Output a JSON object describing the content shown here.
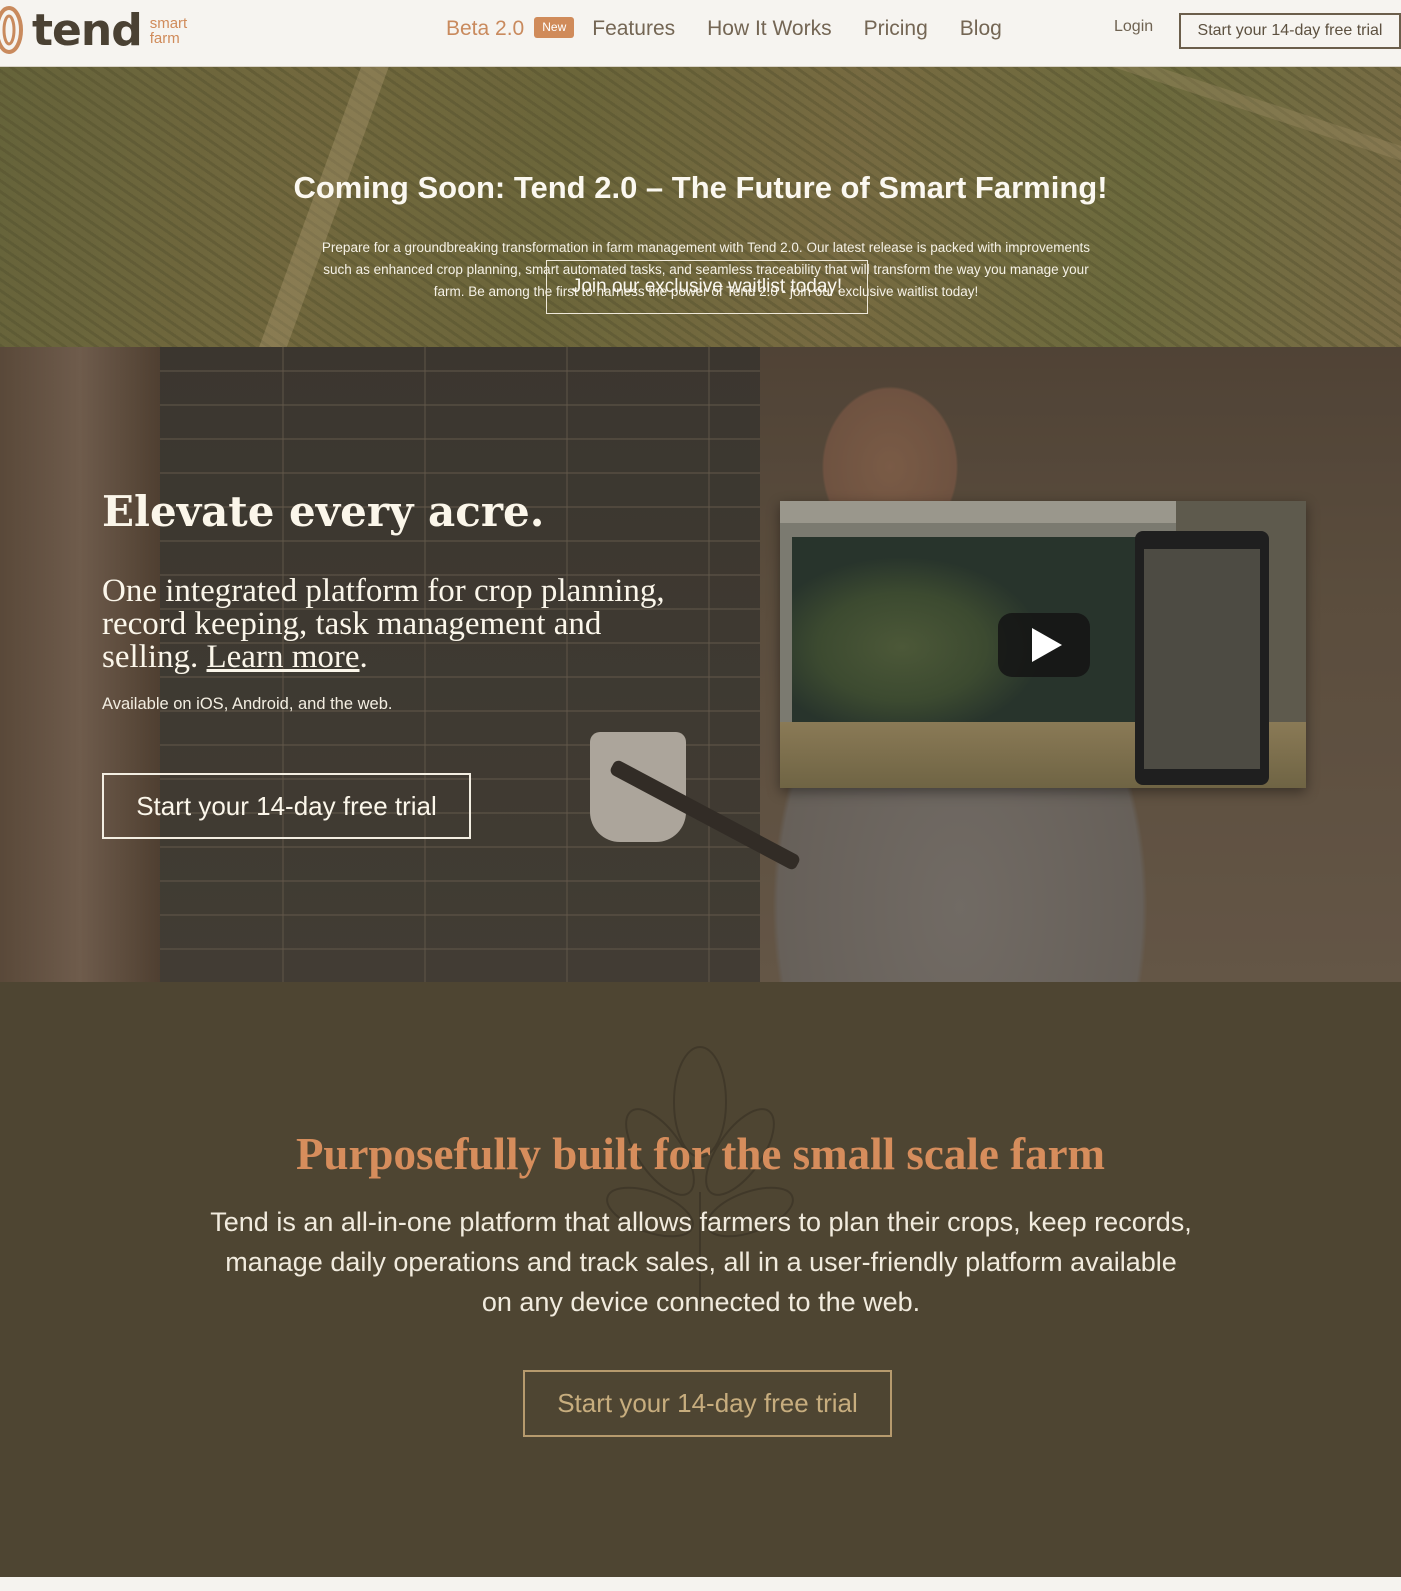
{
  "nav": {
    "logo_word": "tend",
    "logo_tag_line1": "smart",
    "logo_tag_line2": "farm",
    "links": {
      "beta": "Beta 2.0",
      "badge": "New",
      "features": "Features",
      "how": "How It Works",
      "pricing": "Pricing",
      "blog": "Blog"
    },
    "login": "Login",
    "cta": "Start your 14-day free trial"
  },
  "banner": {
    "title": "Coming Soon: Tend 2.0 – The Future of Smart Farming!",
    "text": "Prepare for a groundbreaking transformation in farm management with Tend 2.0. Our latest release is packed with improvements such as enhanced crop planning, smart automated tasks, and seamless traceability that will transform the way you manage your farm. Be among the first to harness the power of Tend 2.0 - join our exclusive waitlist today!",
    "button": "Join our exclusive waitlist today!"
  },
  "hero": {
    "title": "Elevate every acre.",
    "subtitle": "One integrated platform for crop planning, record keeping, task management and selling.",
    "learn_more": "Learn more",
    "period": ".",
    "availability": "Available on iOS, Android, and the web.",
    "cta": "Start your 14-day free trial"
  },
  "about": {
    "title": "Purposefully built for the small scale farm",
    "text": "Tend is an all-in-one platform that allows farmers to plan their crops, keep records, manage daily operations and track sales, all in a user-friendly platform available on any device connected to the web.",
    "cta": "Start your 14-day free trial"
  },
  "colors": {
    "accent": "#d08b5a",
    "nav_bg": "#f6f4f0",
    "about_bg": "#4e4532"
  },
  "icons": {
    "logo": "tend-leaf-logo",
    "play": "play-icon",
    "flower": "flower-illustration"
  }
}
